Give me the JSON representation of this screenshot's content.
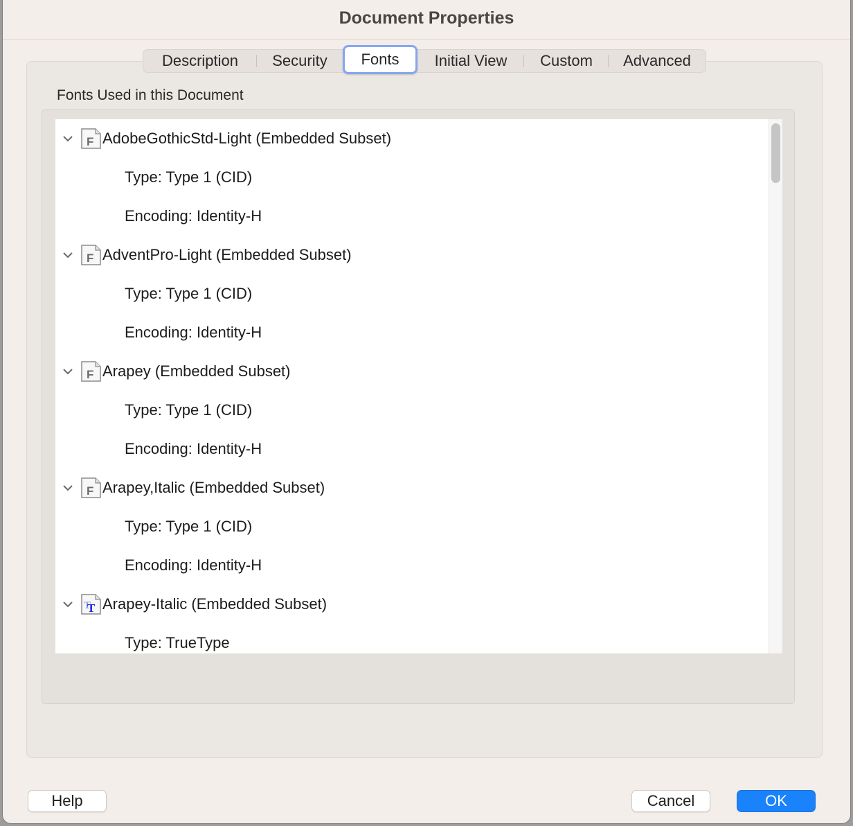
{
  "dialog": {
    "title": "Document Properties"
  },
  "tabs": [
    {
      "label": "Description",
      "active": false
    },
    {
      "label": "Security",
      "active": false
    },
    {
      "label": "Fonts",
      "active": true
    },
    {
      "label": "Initial View",
      "active": false
    },
    {
      "label": "Custom",
      "active": false
    },
    {
      "label": "Advanced",
      "active": false
    }
  ],
  "fonts_section": {
    "label": "Fonts Used in this Document",
    "fonts": [
      {
        "name": "AdobeGothicStd-Light (Embedded Subset)",
        "icon": "type1-font-icon",
        "type": "Type: Type 1 (CID)",
        "encoding": "Encoding: Identity-H"
      },
      {
        "name": "AdventPro-Light (Embedded Subset)",
        "icon": "type1-font-icon",
        "type": "Type: Type 1 (CID)",
        "encoding": "Encoding: Identity-H"
      },
      {
        "name": "Arapey (Embedded Subset)",
        "icon": "type1-font-icon",
        "type": "Type: Type 1 (CID)",
        "encoding": "Encoding: Identity-H"
      },
      {
        "name": "Arapey,Italic (Embedded Subset)",
        "icon": "type1-font-icon",
        "type": "Type: Type 1 (CID)",
        "encoding": "Encoding: Identity-H"
      },
      {
        "name": "Arapey-Italic (Embedded Subset)",
        "icon": "truetype-font-icon",
        "type": "Type: TrueType",
        "encoding": ""
      }
    ]
  },
  "buttons": {
    "help": "Help",
    "cancel": "Cancel",
    "ok": "OK"
  },
  "colors": {
    "accent": "#1a82fb",
    "tab_focus": "#86a6f0",
    "truetype_icon": "#1f2bd6"
  }
}
